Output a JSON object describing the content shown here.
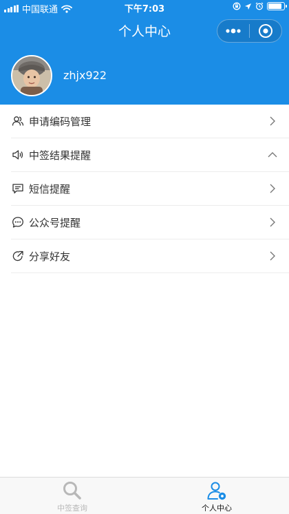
{
  "status_bar": {
    "carrier": "中国联通",
    "time": "下午7:03"
  },
  "nav": {
    "title": "个人中心"
  },
  "profile": {
    "username": "zhjx922"
  },
  "menu": [
    {
      "label": "申请编码管理",
      "icon": "user-group-icon",
      "arrow": "right"
    },
    {
      "label": "中签结果提醒",
      "icon": "speaker-icon",
      "arrow": "up"
    },
    {
      "label": "短信提醒",
      "icon": "message-icon",
      "arrow": "right"
    },
    {
      "label": "公众号提醒",
      "icon": "chat-bubble-icon",
      "arrow": "right"
    },
    {
      "label": "分享好友",
      "icon": "share-icon",
      "arrow": "right"
    }
  ],
  "tabbar": {
    "tabs": [
      {
        "label": "中签查询",
        "icon": "search-icon",
        "active": false
      },
      {
        "label": "个人中心",
        "icon": "user-settings-icon",
        "active": true
      }
    ]
  },
  "colors": {
    "primary": "#1b8de6",
    "tab_inactive": "#b8b8b8",
    "tab_active_icon": "#1b8de6"
  }
}
